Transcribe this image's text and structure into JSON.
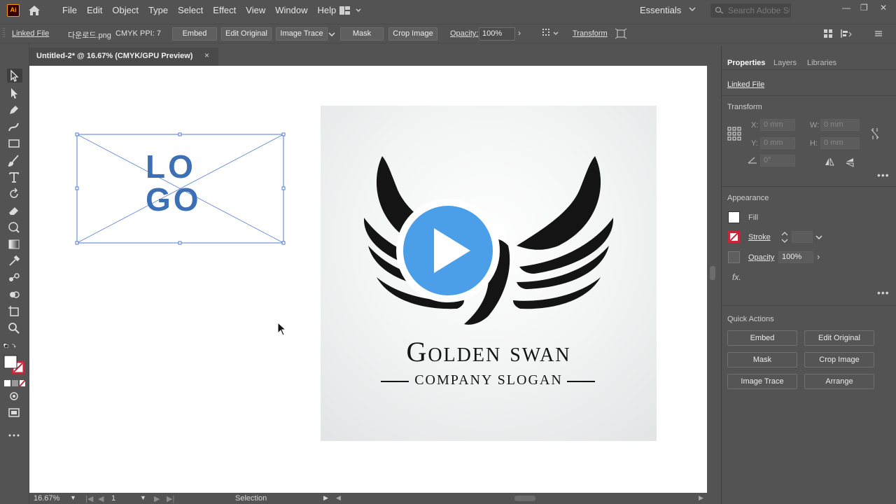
{
  "app": {
    "logo_text": "Ai",
    "menus": [
      "File",
      "Edit",
      "Object",
      "Type",
      "Select",
      "Effect",
      "View",
      "Window",
      "Help"
    ],
    "workspace": "Essentials",
    "search_placeholder": "Search Adobe Stock"
  },
  "control_bar": {
    "linked_file": "Linked File",
    "filename": "다운로드.png",
    "color_mode": "CMYK",
    "ppi": "PPI: 7",
    "embed": "Embed",
    "edit_original": "Edit Original",
    "image_trace": "Image Trace",
    "mask": "Mask",
    "crop_image": "Crop Image",
    "opacity_label": "Opacity:",
    "opacity_value": "100%",
    "transform": "Transform"
  },
  "document": {
    "tab_title": "Untitled-2* @ 16.67% (CMYK/GPU Preview)",
    "close": "×"
  },
  "status_bar": {
    "zoom": "16.67%",
    "artboard": "1",
    "tool": "Selection"
  },
  "panel": {
    "tabs": [
      "Properties",
      "Layers",
      "Libraries"
    ],
    "linked_file": "Linked File",
    "transform_title": "Transform",
    "x_label": "X:",
    "x_value": "0 mm",
    "y_label": "Y:",
    "y_value": "0 mm",
    "w_label": "W:",
    "w_value": "0 mm",
    "h_label": "H:",
    "h_value": "0 mm",
    "angle_value": "0°",
    "appearance_title": "Appearance",
    "fill": "Fill",
    "stroke": "Stroke",
    "opacity": "Opacity",
    "opacity_value": "100%",
    "fx": "fx.",
    "quick_actions_title": "Quick Actions",
    "quick_actions": [
      "Embed",
      "Edit Original",
      "Mask",
      "Crop Image",
      "Image Trace",
      "Arrange"
    ]
  },
  "artwork": {
    "placeholder_text_1": "LO",
    "placeholder_text_2": "GO",
    "swan_title": "Golden swan",
    "swan_slogan": "COMPANY SLOGAN"
  },
  "colors": {
    "ui_bg": "#535353",
    "logo_blue": "#3d6fb4",
    "play_blue": "#4a9fe8",
    "accent_orange": "#ff9a00"
  }
}
